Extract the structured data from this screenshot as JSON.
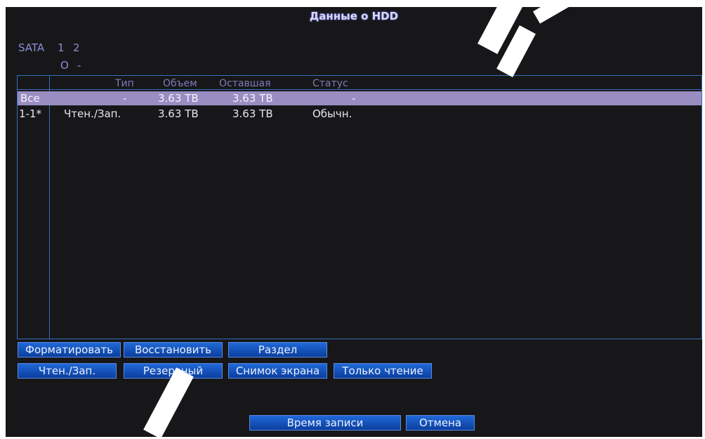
{
  "window": {
    "title": "Данные о HDD"
  },
  "sata": {
    "label": "SATA",
    "ports": [
      {
        "number": "1",
        "status": "O"
      },
      {
        "number": "2",
        "status": "-"
      }
    ]
  },
  "table": {
    "headers": {
      "type": "Тип",
      "capacity": "Объем",
      "remaining": "Оставшая",
      "status": "Статус"
    },
    "rows": [
      {
        "id": "Все",
        "type": "-",
        "capacity": "3.63 TB",
        "remaining": "3.63 TB",
        "status": "-",
        "selected": true
      },
      {
        "id": "1-1*",
        "type": "Чтен./Зап.",
        "capacity": "3.63 TB",
        "remaining": "3.63 TB",
        "status": "Обычн.",
        "selected": false
      }
    ]
  },
  "buttons": {
    "format": "Форматировать",
    "restore": "Восстановить",
    "partition": "Раздел",
    "read_write": "Чтен./Зап.",
    "backup": "Резервный",
    "snapshot": "Снимок экрана",
    "read_only": "Только чтение",
    "record_time": "Время записи",
    "cancel": "Отмена"
  },
  "colors": {
    "background": "#17171a",
    "border": "#3570b8",
    "selected_row": "#9a8dc2",
    "button": "#1554bf"
  }
}
